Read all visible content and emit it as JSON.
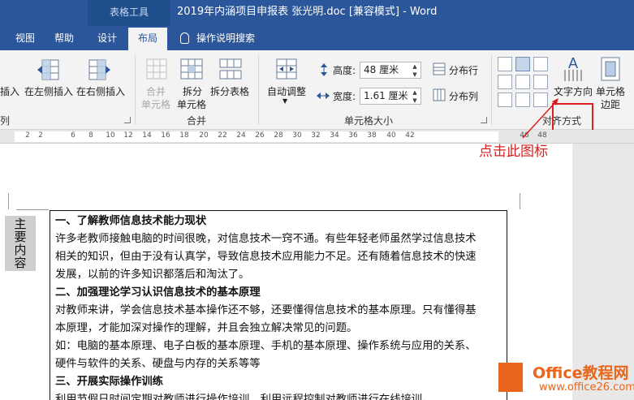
{
  "titlebar": {
    "context_tab": "表格工具",
    "doc_title": "2019年内涵项目申报表 张光明.doc [兼容模式]  -  Word"
  },
  "tabs": [
    "视图",
    "帮助",
    "设计",
    "布局"
  ],
  "tell_me": "操作说明搜索",
  "ribbon": {
    "insert_cut": "插入",
    "insert_left": "在左侧插入",
    "insert_right": "在右侧插入",
    "rows_cols_group_cut": "列",
    "merge_cells_1": "合并",
    "merge_cells_2": "单元格",
    "split_cells_1": "拆分",
    "split_cells_2": "单元格",
    "split_table": "拆分表格",
    "merge_group": "合并",
    "autofit": "自动调整",
    "height_label": "高度:",
    "height_value": "48 厘米",
    "width_label": "宽度:",
    "width_value": "1.61 厘米",
    "distribute_rows": "分布行",
    "distribute_cols": "分布列",
    "cell_size_group": "单元格大小",
    "text_direction": "文字方向",
    "cell_margins_1": "单元格",
    "cell_margins_2": "边距",
    "alignment_group": "对齐方式"
  },
  "ruler_ticks": [
    "2",
    "2",
    "6",
    "8",
    "10",
    "12",
    "14",
    "16",
    "18",
    "20",
    "22",
    "24",
    "26",
    "28",
    "30",
    "32",
    "34",
    "36",
    "38",
    "40",
    "42",
    "46",
    "48"
  ],
  "callout": "点击此图标",
  "table": {
    "header_chars": [
      "主",
      "要",
      "内",
      "容"
    ],
    "lines": [
      {
        "text": "一、了解教师信息技术能力现状",
        "bold": true
      },
      {
        "text": "许多老教师接触电脑的时间很晚，对信息技术一窍不通。有些年轻老师虽然学过信息技术",
        "bold": false
      },
      {
        "text": "相关的知识，但由于没有认真学，导致信息技术应用能力不足。还有随着信息技术的快速",
        "bold": false
      },
      {
        "text": "发展，以前的许多知识都落后和淘汰了。",
        "bold": false
      },
      {
        "text": "二、加强理论学习认识信息技术的基本原理",
        "bold": true
      },
      {
        "text": "对教师来讲，学会信息技术基本操作还不够，还要懂得信息技术的基本原理。只有懂得基",
        "bold": false
      },
      {
        "text": "本原理，才能加深对操作的理解，并且会独立解决常见的问题。",
        "bold": false
      },
      {
        "text": "如：电脑的基本原理、电子白板的基本原理、手机的基本原理、操作系统与应用的关系、",
        "bold": false
      },
      {
        "text": "硬件与软件的关系、硬盘与内存的关系等等",
        "bold": false
      },
      {
        "text": "三、开展实际操作训练",
        "bold": true
      },
      {
        "text": "利用节假日时间定期对教师进行操作培训，利用远程控制对教师进行在线培训。",
        "bold": false
      }
    ]
  },
  "watermark": {
    "line1": "Office教程网",
    "line2": "www.office26.com"
  },
  "colors": {
    "word_blue": "#2b579a",
    "callout_red": "#d81e1e",
    "watermark_orange": "#e8671c"
  }
}
